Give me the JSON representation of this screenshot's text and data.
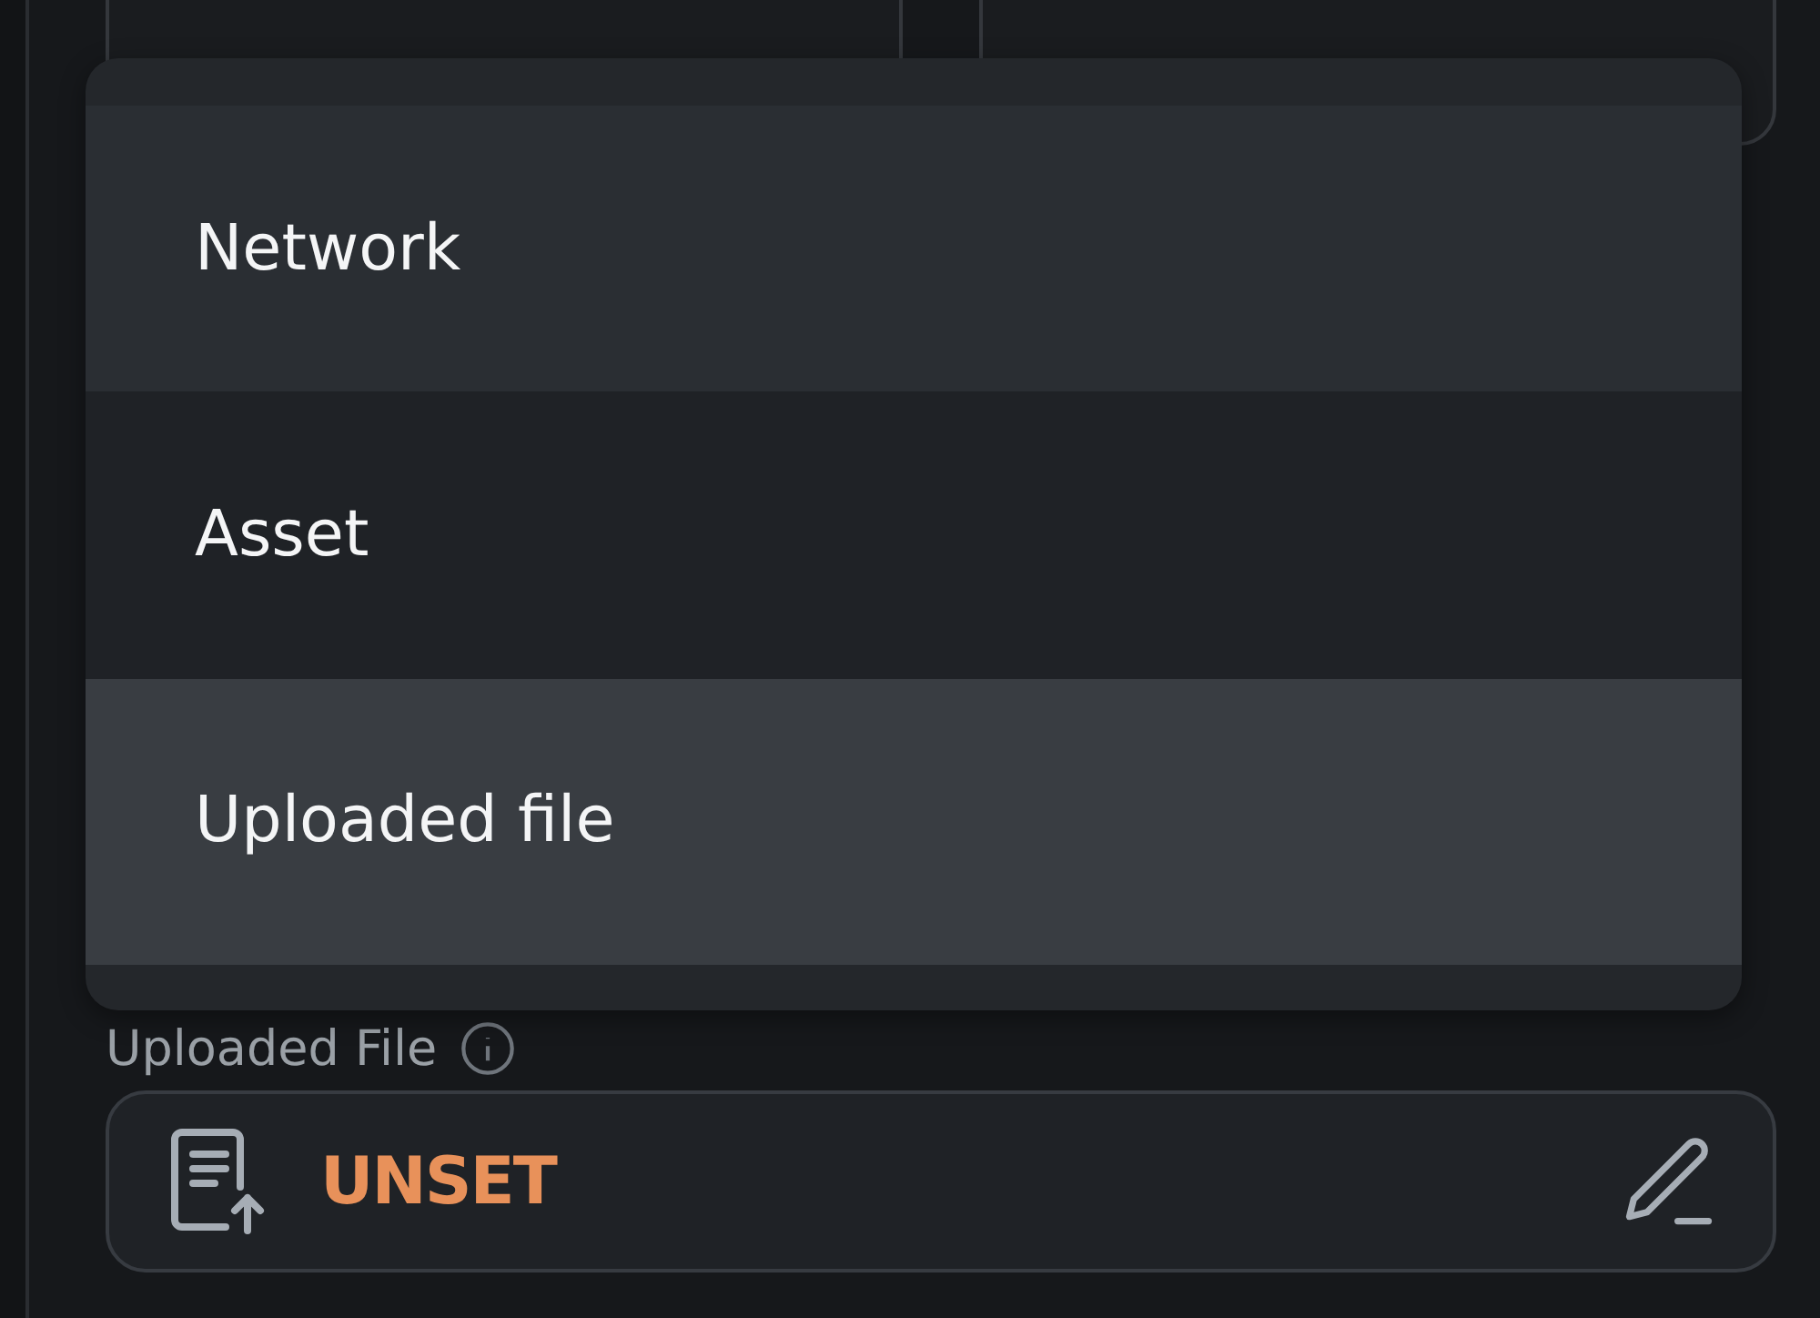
{
  "menu": {
    "items": [
      {
        "label": "Network",
        "selected": false
      },
      {
        "label": "Asset",
        "selected": false
      },
      {
        "label": "Uploaded file",
        "selected": true
      }
    ]
  },
  "field": {
    "label": "Uploaded File",
    "value": "UNSET"
  }
}
